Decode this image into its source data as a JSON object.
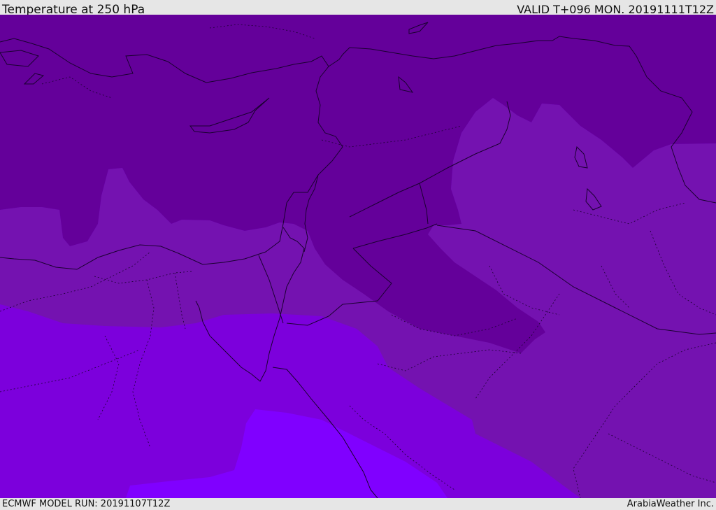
{
  "header": {
    "title": "Temperature at 250 hPa",
    "valid": "VALID T+096 MON. 20191111T12Z"
  },
  "footer": {
    "model_run": "ECMWF MODEL RUN: 20191107T12Z",
    "brand": "ArabiaWeather Inc."
  },
  "colors": {
    "coldest": "#64009a",
    "cold": "#7412b0",
    "mild": "#7c00dc",
    "warm": "#8000ff",
    "borders": "#1a0030"
  }
}
